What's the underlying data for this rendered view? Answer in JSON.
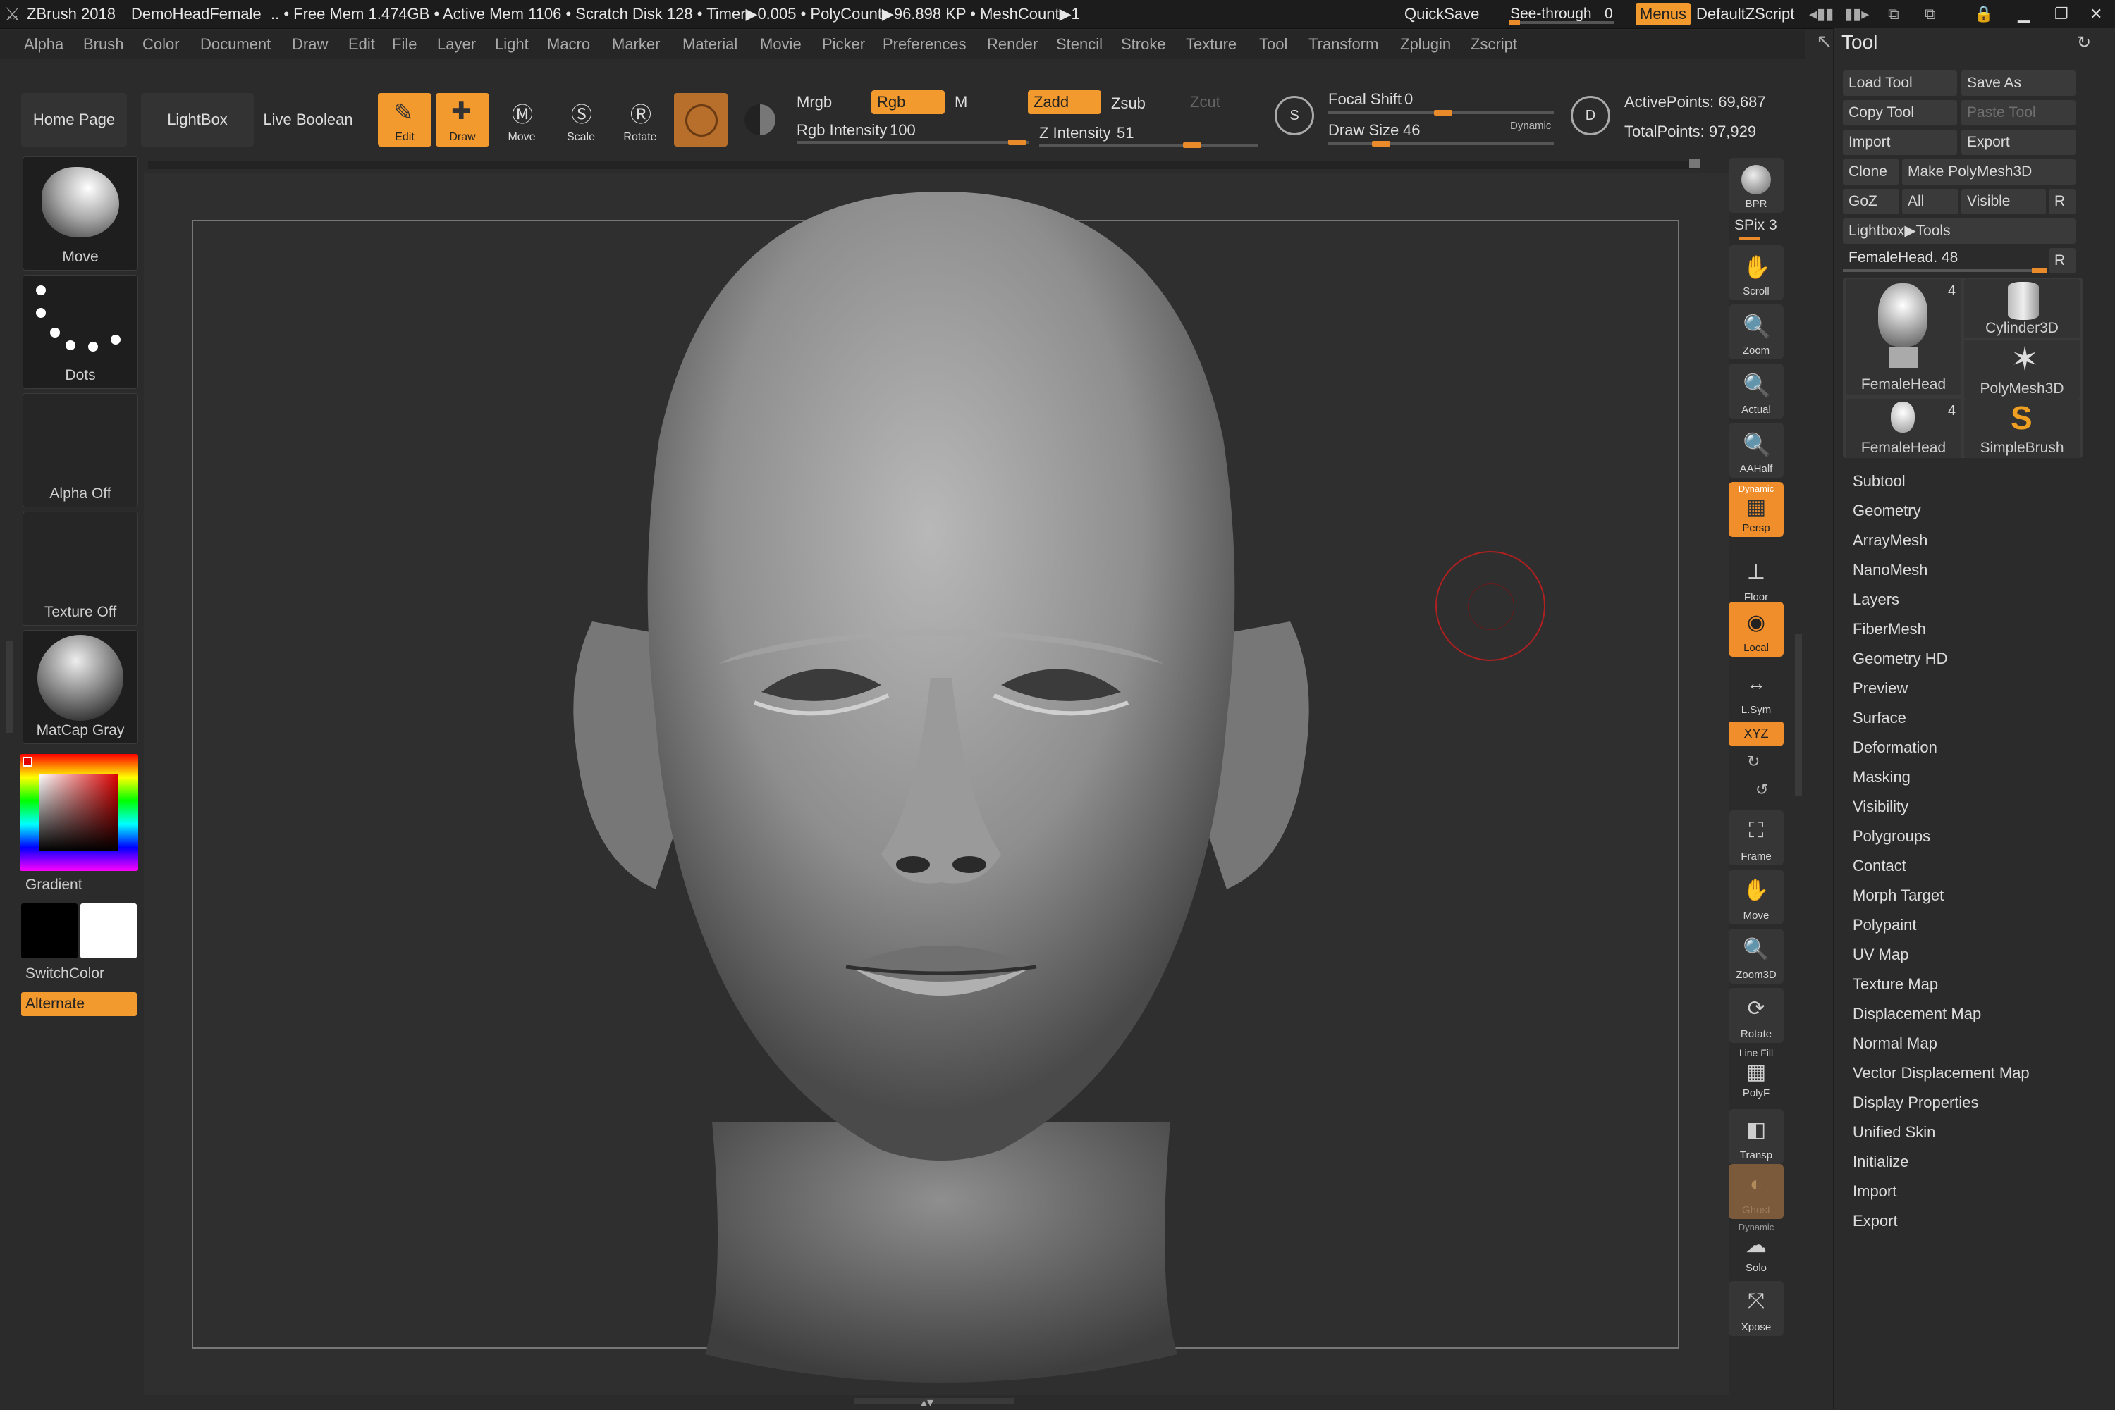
{
  "titlebar": {
    "app": "ZBrush 2018",
    "document": "DemoHeadFemale",
    "stats": ".. • Free Mem 1.474GB • Active Mem 1106 • Scratch Disk 128 • Timer▶0.005 • PolyCount▶96.898 KP • MeshCount▶1",
    "quicksave": "QuickSave",
    "see_through": "See-through",
    "see_through_value": "0",
    "menus_button": "Menus",
    "script": "DefaultZScript"
  },
  "menubar": {
    "items": [
      "Alpha",
      "Brush",
      "Color",
      "Document",
      "Draw",
      "Edit",
      "File",
      "Layer",
      "Light",
      "Macro",
      "Marker",
      "Material",
      "Movie",
      "Picker",
      "Preferences",
      "Render",
      "Stencil",
      "Stroke",
      "Texture",
      "Tool",
      "Transform",
      "Zplugin",
      "Zscript"
    ]
  },
  "toolbar": {
    "home_page": "Home Page",
    "lightbox": "LightBox",
    "live_boolean": "Live Boolean",
    "edit": "Edit",
    "draw": "Draw",
    "move": "Move",
    "scale": "Scale",
    "rotate": "Rotate",
    "mrgb": "Mrgb",
    "rgb": "Rgb",
    "m": "M",
    "zadd": "Zadd",
    "zsub": "Zsub",
    "zcut": "Zcut",
    "rgb_intensity_label": "Rgb Intensity",
    "rgb_intensity": "100",
    "z_intensity_label": "Z Intensity",
    "z_intensity": "51",
    "focal_shift_label": "Focal Shift",
    "focal_shift": "0",
    "draw_size_label": "Draw Size",
    "draw_size": "46",
    "dynamic": "Dynamic",
    "active_points": "ActivePoints: 69,687",
    "total_points": "TotalPoints: 97,929"
  },
  "left_shelf": {
    "brush": "Move",
    "stroke": "Dots",
    "alpha": "Alpha Off",
    "texture": "Texture Off",
    "material": "MatCap Gray",
    "gradient": "Gradient",
    "switch_color": "SwitchColor",
    "alternate": "Alternate"
  },
  "right_shelf": {
    "bpr": "BPR",
    "spix": "SPix 3",
    "scroll": "Scroll",
    "zoom": "Zoom",
    "actual": "Actual",
    "aahalf": "AAHalf",
    "persp_top": "Dynamic",
    "persp": "Persp",
    "floor": "Floor",
    "local": "Local",
    "lsym": "L.Sym",
    "xyz": "XYZ",
    "frame": "Frame",
    "move": "Move",
    "zoom3d": "Zoom3D",
    "rotate": "Rotate",
    "polyf_top": "Line Fill",
    "polyf": "PolyF",
    "transp": "Transp",
    "ghost": "Ghost",
    "solo_top": "Dynamic",
    "solo": "Solo",
    "xpose": "Xpose"
  },
  "tool_panel": {
    "title": "Tool",
    "load_tool": "Load Tool",
    "save_as": "Save As",
    "copy_tool": "Copy Tool",
    "paste_tool": "Paste Tool",
    "import": "Import",
    "export": "Export",
    "clone": "Clone",
    "make_polymesh": "Make PolyMesh3D",
    "goz": "GoZ",
    "all": "All",
    "visible": "Visible",
    "r": "R",
    "lightbox_tools": "Lightbox▶Tools",
    "current_tool": "FemaleHead. 48",
    "thumbs": [
      {
        "label": "FemaleHead",
        "count": "4"
      },
      {
        "label": "Cylinder3D",
        "count": ""
      },
      {
        "label": "PolyMesh3D",
        "count": ""
      },
      {
        "label": "FemaleHead",
        "count": "4"
      },
      {
        "label": "SimpleBrush",
        "count": ""
      }
    ],
    "subpalettes": [
      "Subtool",
      "Geometry",
      "ArrayMesh",
      "NanoMesh",
      "Layers",
      "FiberMesh",
      "Geometry HD",
      "Preview",
      "Surface",
      "Deformation",
      "Masking",
      "Visibility",
      "Polygroups",
      "Contact",
      "Morph Target",
      "Polypaint",
      "UV Map",
      "Texture Map",
      "Displacement Map",
      "Normal Map",
      "Vector Displacement Map",
      "Display Properties",
      "Unified Skin",
      "Initialize",
      "Import",
      "Export"
    ]
  },
  "colors": {
    "accent": "#f29a2e",
    "background": "#2b2b2b",
    "brush_cursor": "#c02020"
  }
}
